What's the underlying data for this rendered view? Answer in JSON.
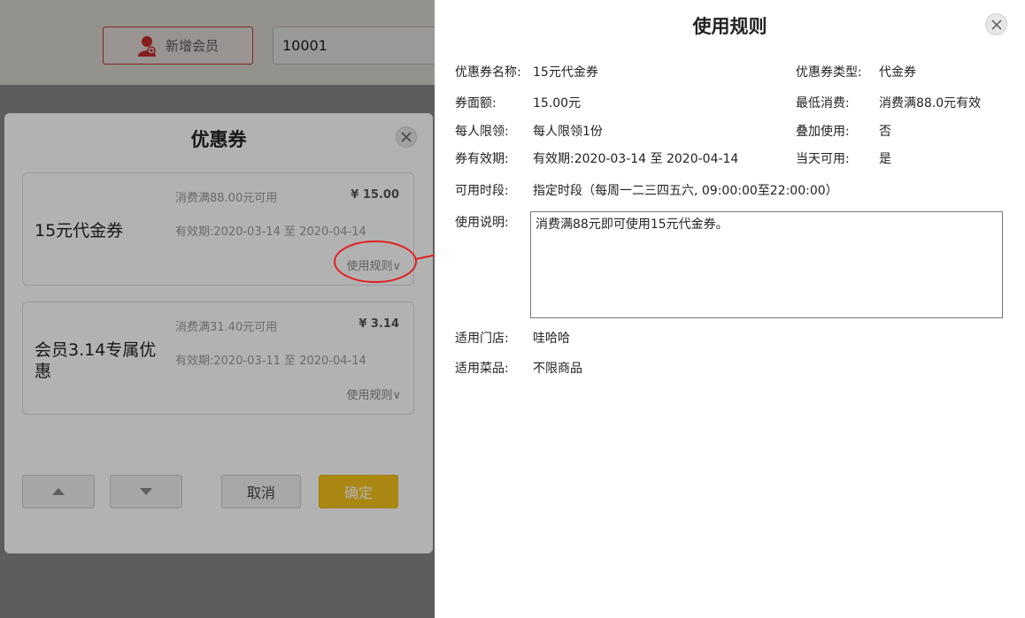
{
  "app": {
    "add_member_label": "新增会员",
    "member_input_value": "10001"
  },
  "coupon_dialog": {
    "title": "优惠券",
    "cards": [
      {
        "name": "15元代金券",
        "condition": "消费满88.00元可用",
        "amount": "¥ 15.00",
        "validity": "有效期:2020-03-14 至 2020-04-14",
        "rule_link": "使用规则∨"
      },
      {
        "name": "会员3.14专属优惠",
        "condition": "消费满31.40元可用",
        "amount": "¥ 3.14",
        "validity": "有效期:2020-03-11 至 2020-04-14",
        "rule_link": "使用规则∨"
      }
    ],
    "cancel_label": "取消",
    "confirm_label": "确定"
  },
  "rules_panel": {
    "title": "使用规则",
    "name_label": "优惠券名称:",
    "name_value": "15元代金券",
    "type_label": "优惠券类型:",
    "type_value": "代金券",
    "face_label": "券面额:",
    "face_value": "15.00元",
    "min_label": "最低消费:",
    "min_value": "消费满88.0元有效",
    "limit_label": "每人限领:",
    "limit_value": "每人限领1份",
    "stack_label": "叠加使用:",
    "stack_value": "否",
    "valid_label": "券有效期:",
    "valid_value": "有效期:2020-03-14 至 2020-04-14",
    "sameday_label": "当天可用:",
    "sameday_value": "是",
    "period_label": "可用时段:",
    "period_value": "指定时段（每周一二三四五六, 09:00:00至22:00:00）",
    "desc_label": "使用说明:",
    "desc_value": "消费满88元即可使用15元代金券。",
    "store_label": "适用门店:",
    "store_value": "哇哈哈",
    "dish_label": "适用菜品:",
    "dish_value": "不限商品"
  },
  "colors": {
    "confirm_yellow": "#f3c21b",
    "highlight_red": "#e02020"
  }
}
